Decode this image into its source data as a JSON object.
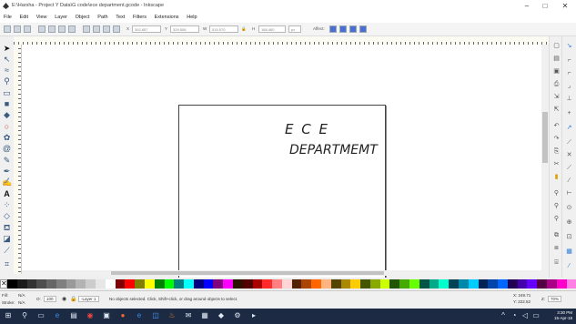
{
  "window": {
    "title": "E:\\Harsha - Project Y Data\\G code\\ece department.gcode - Inkscape",
    "minimize": "–",
    "maximize": "□",
    "close": "✕"
  },
  "menu": [
    "File",
    "Edit",
    "View",
    "Layer",
    "Object",
    "Path",
    "Text",
    "Filters",
    "Extensions",
    "Help"
  ],
  "controls": {
    "x_value": "392.857",
    "y_value": "329.508",
    "w_label": "W",
    "w_value": "515.570",
    "h_label": "H",
    "h_value": "168.460",
    "unit": "px",
    "affect_label": "Affect:"
  },
  "canvas": {
    "line1": "E C E",
    "line2": "DEPARTMEMT"
  },
  "status": {
    "fill_label": "Fill:",
    "fill_value": "N/A",
    "stroke_label": "Stroke:",
    "stroke_value": "N/A",
    "opacity_label": "O:",
    "opacity_value": "100",
    "layer": "-Layer 1",
    "message": "No objects selected. Click, Shift+click, or drag around objects to select.",
    "x_coord": "X: 249.71",
    "y_coord": "Y: 222.52",
    "zoom_label": "Z:",
    "zoom_value": "70%"
  },
  "taskbar": {
    "time": "3:30 PM",
    "date": "15-Apr-18"
  },
  "colors": {
    "page_border": "#444444",
    "taskbar": "#1c2a44",
    "toolbar_bg": "#f0f0f0"
  }
}
